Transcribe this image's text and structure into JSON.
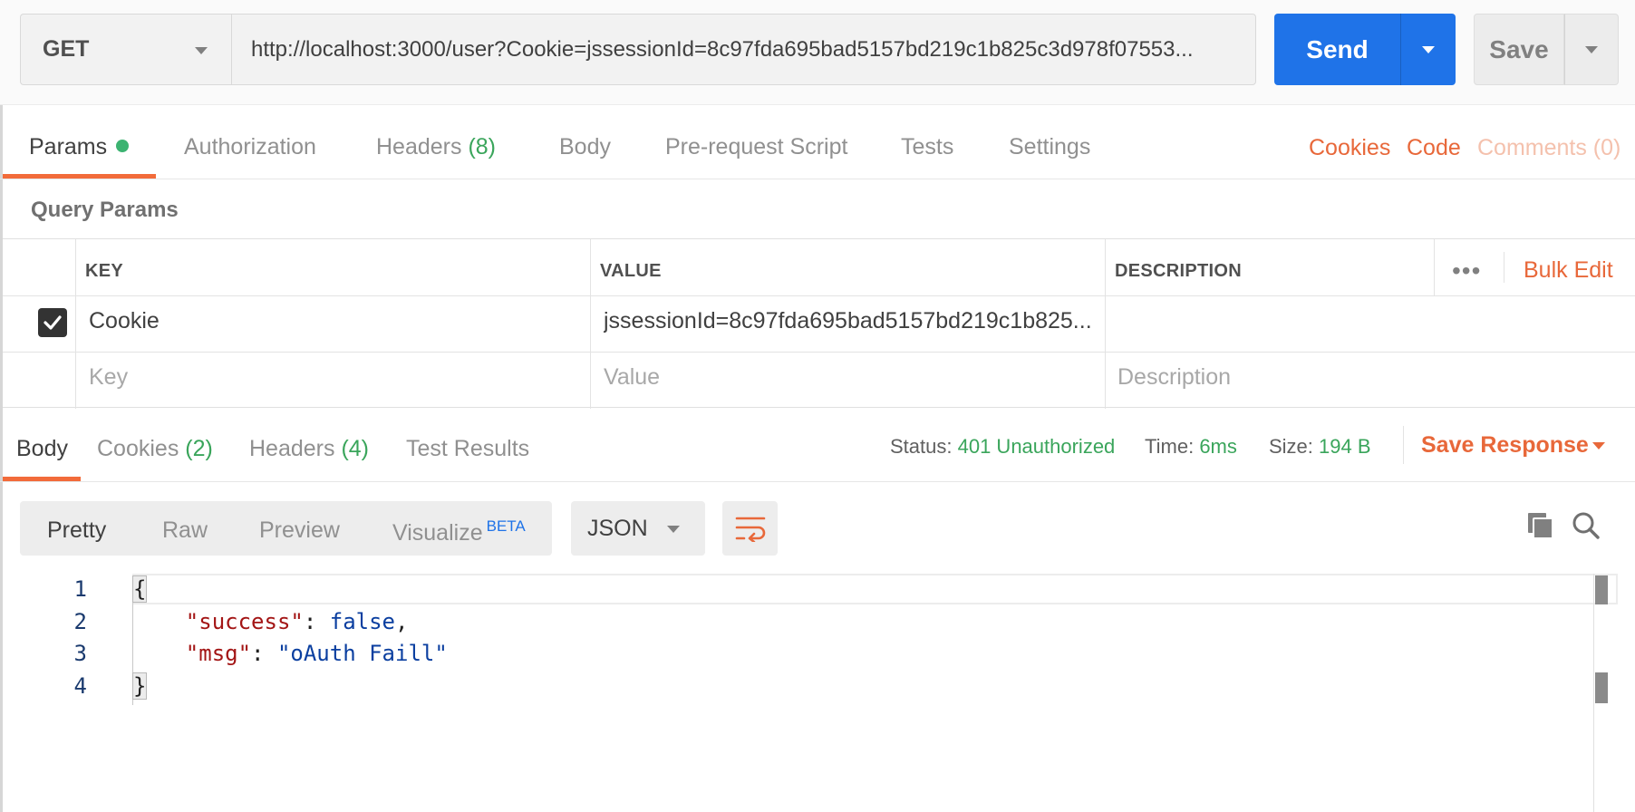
{
  "request": {
    "method": "GET",
    "url": "http://localhost:3000/user?Cookie=jssessionId=8c97fda695bad5157bd219c1b825c3d978f07553...",
    "send_label": "Send",
    "save_label": "Save"
  },
  "request_tabs": {
    "params": "Params",
    "authorization": "Authorization",
    "headers": "Headers",
    "headers_count": "(8)",
    "body": "Body",
    "prerequest": "Pre-request Script",
    "tests": "Tests",
    "settings": "Settings",
    "cookies": "Cookies",
    "code": "Code",
    "comments": "Comments (0)"
  },
  "query_params": {
    "title": "Query Params",
    "columns": {
      "key": "KEY",
      "value": "VALUE",
      "description": "DESCRIPTION"
    },
    "bulk_edit": "Bulk Edit",
    "more": "•••",
    "rows": [
      {
        "checked": true,
        "key": "Cookie",
        "value": "jssessionId=8c97fda695bad5157bd219c1b825...",
        "description": ""
      }
    ],
    "placeholders": {
      "key": "Key",
      "value": "Value",
      "description": "Description"
    }
  },
  "response_tabs": {
    "body": "Body",
    "cookies": "Cookies",
    "cookies_count": "(2)",
    "headers": "Headers",
    "headers_count": "(4)",
    "test_results": "Test Results"
  },
  "response_status": {
    "status_label": "Status:",
    "status_value": "401 Unauthorized",
    "time_label": "Time:",
    "time_value": "6ms",
    "size_label": "Size:",
    "size_value": "194 B",
    "save_response": "Save Response"
  },
  "viewer": {
    "pretty": "Pretty",
    "raw": "Raw",
    "preview": "Preview",
    "visualize": "Visualize",
    "beta": "BETA",
    "format": "JSON"
  },
  "code": {
    "line_numbers": [
      "1",
      "2",
      "3",
      "4"
    ],
    "open_brace": "{",
    "close_brace": "}",
    "key1": "\"success\"",
    "val1": "false",
    "key2": "\"msg\"",
    "val2": "\"oAuth Faill\""
  },
  "colors": {
    "send_blue": "#1f73e8",
    "accent_orange": "#e8683a",
    "status_green": "#3aa55b"
  },
  "icons": [
    "chevron-down-icon",
    "checkmark-icon",
    "wrap-lines-icon",
    "copy-icon",
    "search-icon"
  ]
}
